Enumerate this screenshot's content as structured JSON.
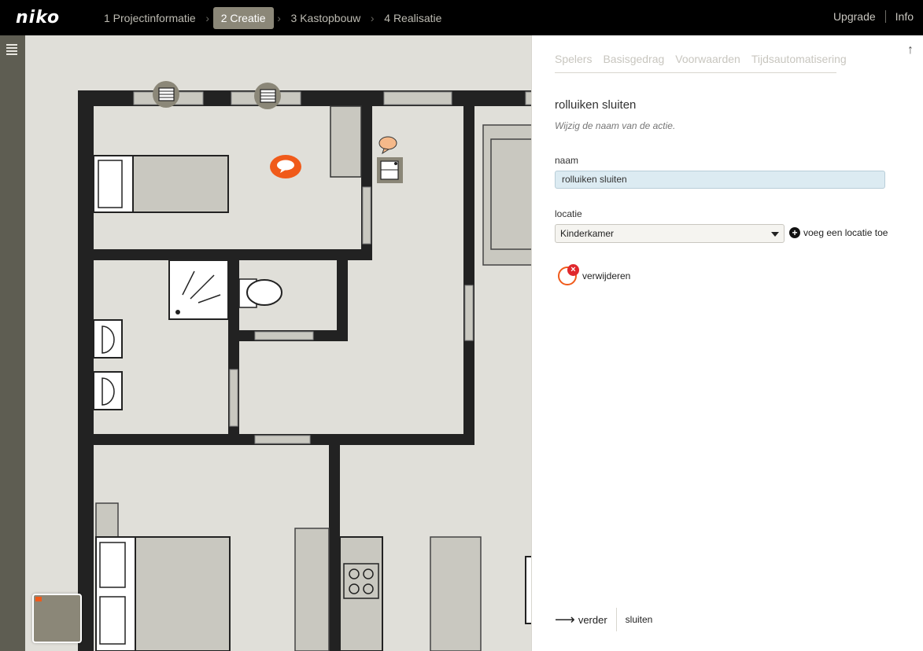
{
  "brand": {
    "logo": "niko",
    "accent_color": "#f05a1a",
    "active_step_color": "#8b8778"
  },
  "steps": [
    {
      "label": "1 Projectinformatie",
      "active": false
    },
    {
      "label": "2 Creatie",
      "active": true
    },
    {
      "label": "3 Kastopbouw",
      "active": false
    },
    {
      "label": "4 Realisatie",
      "active": false
    }
  ],
  "toplinks": {
    "upgrade": "Upgrade",
    "info": "Info"
  },
  "panel": {
    "tabs": [
      "Spelers",
      "Basisgedrag",
      "Voorwaarden",
      "Tijdsautomatisering"
    ],
    "title": "rolluiken sluiten",
    "subtitle": "Wijzig de naam van de actie.",
    "name_label": "naam",
    "name_value": "rolluiken sluiten",
    "location_label": "locatie",
    "location_value": "Kinderkamer",
    "add_location": "voeg een locatie toe",
    "delete_label": "verwijderen",
    "next_label": "verder",
    "close_label": "sluiten"
  },
  "icons": {
    "menu": "hamburger-icon",
    "scroll_top": "arrow-up-icon",
    "add": "plus-circle-icon",
    "remove": "x-badge-icon",
    "next": "arrow-right-icon",
    "shutter": "shutter-icon",
    "speech": "speech-bubble-icon",
    "tablet": "tablet-icon"
  }
}
